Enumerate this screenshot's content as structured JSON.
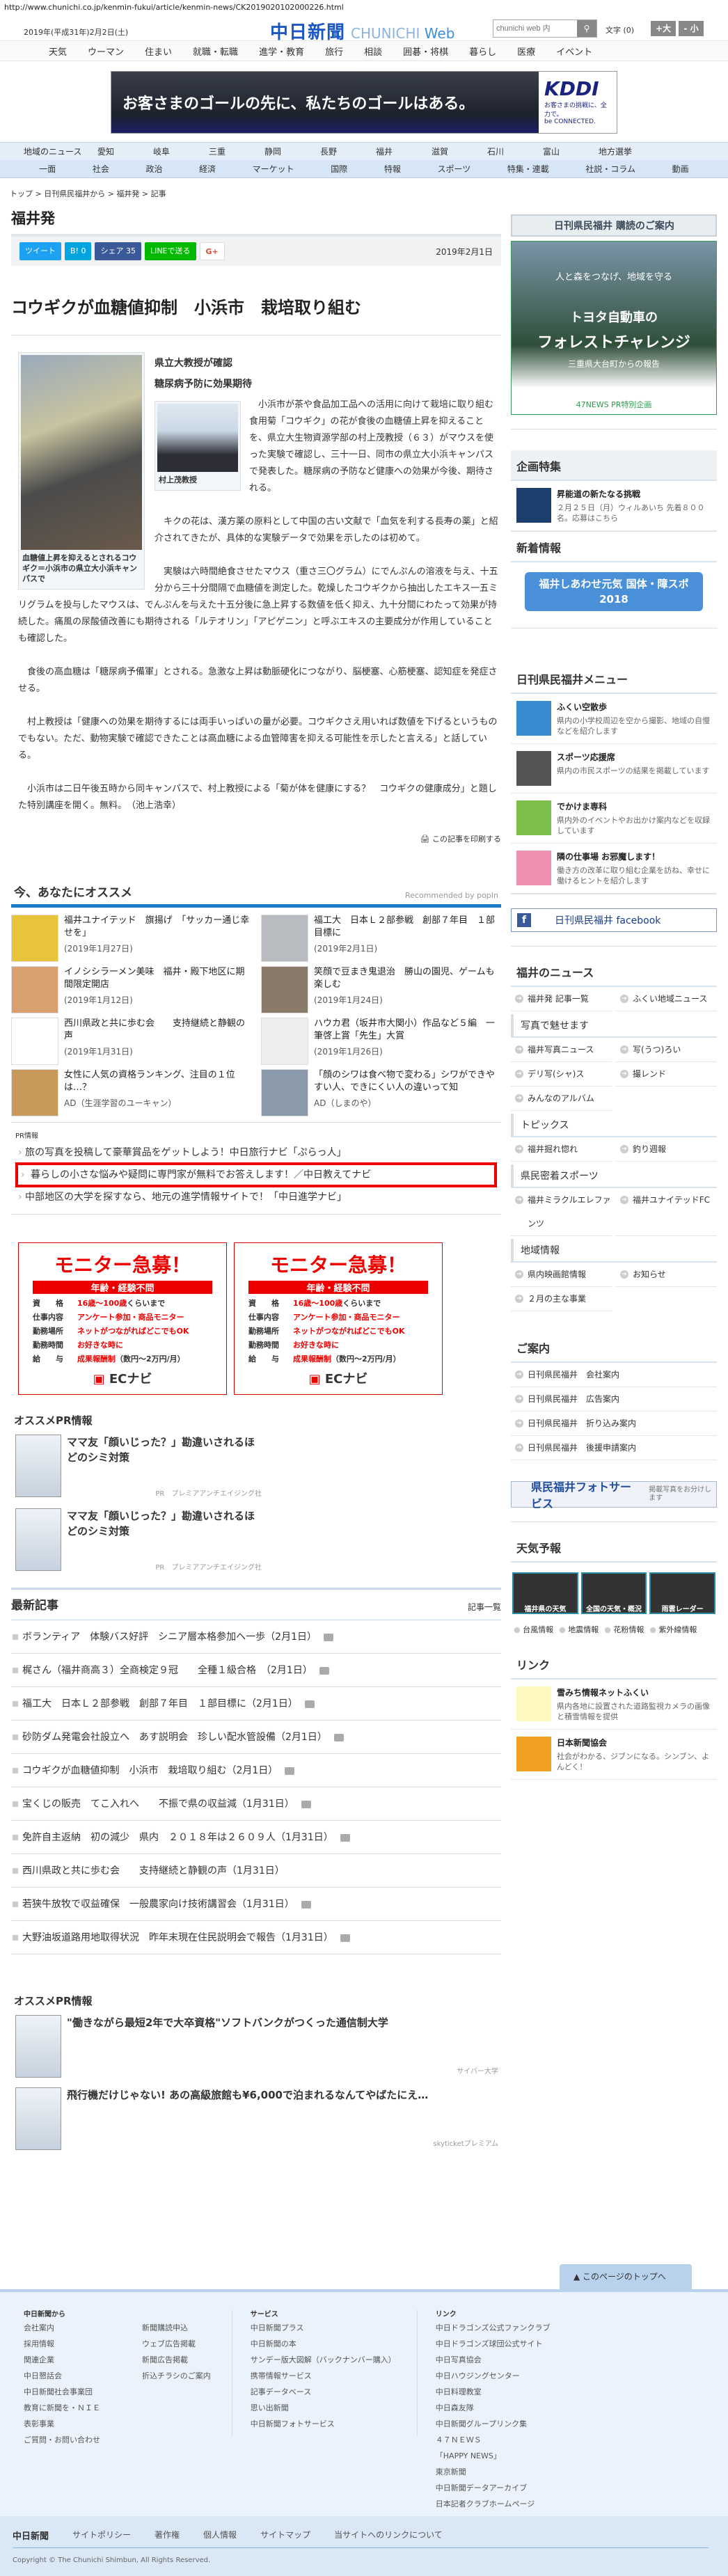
{
  "url": "http://www.chunichi.co.jp/kenmin-fukui/article/kenmin-news/CK2019020102000226.html",
  "header": {
    "date": "2019年(平成31年)2月2日(土)",
    "logo": "中日新聞",
    "logo_sub_a": "CHUNICHI ",
    "logo_sub_b": "Web",
    "search_placeholder": "chunichi web 内",
    "font_label": "文字 (0)",
    "font_plus": "+大",
    "font_minus": "- 小"
  },
  "top_nav": [
    "天気",
    "ウーマン",
    "住まい",
    "就職・転職",
    "進学・教育",
    "旅行",
    "相談",
    "囲碁・将棋",
    "暮らし",
    "医療",
    "イベント"
  ],
  "banner": {
    "text": "お客さまのゴールの先に、私たちのゴールはある。",
    "brand": "KDDI",
    "tagline": "お客さまの挑戦に、全力で。",
    "sub": "be CONNECTED."
  },
  "region_nav": {
    "label": "地域のニュース",
    "items": [
      "愛知",
      "岐阜",
      "三重",
      "静岡",
      "長野",
      "福井",
      "滋賀",
      "石川",
      "富山",
      "地方選挙"
    ]
  },
  "cat_nav": [
    "一面",
    "社会",
    "政治",
    "経済",
    "マーケット",
    "国際",
    "特報",
    "スポーツ",
    "特集・連載",
    "社説・コラム",
    "動画"
  ],
  "breadcrumb": "トップ > 日刊県民福井から > 福井発 > 記事",
  "section": "福井発",
  "share": {
    "tweet": "ツイート",
    "hatena": "B! 0",
    "fb": "シェア 35",
    "line": "LINEで送る",
    "gplus": "G+",
    "date": "2019年2月1日"
  },
  "article": {
    "title": "コウギクが血糖値抑制　小浜市　栽培取り組む",
    "sub1": "県立大教授が確認",
    "sub2": "糖尿病予防に効果期待",
    "photo_caption": "血糖値上昇を抑えるとされるコウギク＝小浜市の県立大小浜キャンパスで",
    "portrait_caption": "村上茂教授",
    "paras": [
      "小浜市が茶や食品加工品への活用に向けて栽培に取り組む食用菊「コウギク」の花が食後の血糖値上昇を抑えることを、県立大生物資源学部の村上茂教授（６３）がマウスを使った実験で確認し、三十一日、同市の県立大小浜キャンパスで発表した。糖尿病の予防など健康への効果が今後、期待される。",
      "キクの花は、漢方薬の原料として中国の古い文献で「血気を利する長寿の薬」と紹介されてきたが、具体的な実験データで効果を示したのは初めて。",
      "実験は六時間絶食させたマウス（重さ三〇グラム）にでんぷんの溶液を与え、十五分から三十分間隔で血糖値を測定した。乾燥したコウギクから抽出したエキス一五ミリグラムを投与したマウスは、でんぷんを与えた十五分後に急上昇する数値を低く抑え、九十分間にわたって効果が持続した。痛風の尿酸値改善にも期待される「ルテオリン」「アピゲニン」と呼ぶエキスの主要成分が作用していることも確認した。",
      "食後の高血糖は「糖尿病予備軍」とされる。急激な上昇は動脈硬化につながり、脳梗塞、心筋梗塞、認知症を発症させる。",
      "村上教授は「健康への効果を期待するには両手いっぱいの量が必要。コウギクさえ用いれば数値を下げるというものでもない。ただ、動物実験で確認できたことは高血糖による血管障害を抑える可能性を示したと言える」と話している。",
      "小浜市は二日午後五時から同キャンパスで、村上教授による「菊が体を健康にする？　コウギクの健康成分」と題した特別講座を開く。無料。　（池上浩幸）"
    ],
    "print": "この記事を印刷する"
  },
  "recommend": {
    "title": "今、あなたにオススメ",
    "by": "Recommended by popIn",
    "items": [
      {
        "title": "福井ユナイテッド　旗揚げ　「サッカー通じ幸せを」",
        "date": "(2019年1月27日)"
      },
      {
        "title": "福工大　日本Ｌ２部参戦　創部７年目　１部目標に",
        "date": "(2019年2月1日)"
      },
      {
        "title": "イノシシラーメン美味　福井・殿下地区に期間限定開店",
        "date": "(2019年1月12日)"
      },
      {
        "title": "笑顔で豆まき鬼退治　勝山の園児、ゲームも楽しむ",
        "date": "(2019年1月24日)"
      },
      {
        "title": "西川県政と共に歩む会　　支持継続と静観の声",
        "date": "(2019年1月31日)"
      },
      {
        "title": "ハウカ君（坂井市大関小）作品など５編　一筆啓上賞「先生」大賞",
        "date": "(2019年1月26日)"
      },
      {
        "title": "女性に人気の資格ランキング、注目の１位は…？",
        "date": "AD（生涯学習のユーキャン）"
      },
      {
        "title": "「顔のシワは食べ物で変わる」シワができやすい人、できにくい人の違いって知",
        "date": "AD（しまのや）"
      }
    ]
  },
  "pr_info": {
    "label": "PR情報",
    "items": [
      "旅の写真を投稿して豪華賞品をゲットしよう！中日旅行ナビ「ぷらっ人」",
      "暮らしの小さな悩みや疑問に専門家が無料でお答えします！／中日教えてナビ",
      "中部地区の大学を探すなら、地元の進学情報サイトで！「中日進学ナビ」"
    ]
  },
  "monitor_ad": {
    "title": "モニター急募！",
    "band": "年齢・経験不問",
    "rows": [
      [
        "資　　格",
        "16歳～100歳",
        "くらいまで"
      ],
      [
        "仕事内容",
        "アンケート参加・商品モニター",
        ""
      ],
      [
        "勤務場所",
        "ネットがつながればどこでもOK",
        ""
      ],
      [
        "勤務時間",
        "お好きな時に",
        ""
      ],
      [
        "給　　与",
        "成果報酬制",
        "（数円～2万円/月）"
      ]
    ],
    "logo": "ECナビ"
  },
  "osusume_pr": {
    "title": "オススメPR情報",
    "items": [
      {
        "title": "ママ友「顔いじった？」勘違いされるほどのシミ対策",
        "src": "PR　プレミアアンチエイジング社"
      },
      {
        "title": "ママ友「顔いじった？」勘違いされるほどのシミ対策",
        "src": "PR　プレミアアンチエイジング社"
      }
    ]
  },
  "latest": {
    "title": "最新記事",
    "more": "記事一覧",
    "items": [
      {
        "t": "ボランティア　体験バス好評　シニア層本格参加へ一歩（2月1日）",
        "cam": true
      },
      {
        "t": "梶さん（福井商高３）全商検定９冠　　全種１級合格　（2月1日）",
        "cam": true
      },
      {
        "t": "福工大　日本Ｌ２部参戦　創部７年目　１部目標に（2月1日）",
        "cam": true
      },
      {
        "t": "砂防ダム発電会社設立へ　あす説明会　珍しい配水管設備（2月1日）",
        "cam": true
      },
      {
        "t": "コウギクが血糖値抑制　小浜市　栽培取り組む（2月1日）",
        "cam": true
      },
      {
        "t": "宝くじの販売　てこ入れへ　　不振で県の収益減（1月31日）",
        "cam": true
      },
      {
        "t": "免許自主返納　初の減少　県内　２０１８年は２６０９人（1月31日）",
        "cam": true
      },
      {
        "t": "西川県政と共に歩む会　　支持継続と静観の声（1月31日）",
        "cam": false
      },
      {
        "t": "若狭牛放牧で収益確保　一般農家向け技術講習会（1月31日）",
        "cam": true
      },
      {
        "t": "大野油坂道路用地取得状況　昨年末現在住民説明会で報告（1月31日）",
        "cam": true
      }
    ]
  },
  "osusume_pr2": {
    "title": "オススメPR情報",
    "items": [
      {
        "title": "\"働きながら最短2年で大卒資格\"ソフトバンクがつくった通信制大学",
        "src": "サイバー大学"
      },
      {
        "title": "飛行機だけじゃない! あの高級旅館も¥6,000で泊まれるなんてやばたにえ…",
        "src": "skyticketプレミアム"
      }
    ]
  },
  "sidebar": {
    "subscribe": "日刊県民福井 購読のご案内",
    "forest": {
      "l1": "人と森をつなげ、地域を守る",
      "l2": "トヨタ自動車の",
      "l3": "フォレストチャレンジ",
      "l4": "三重県大台町からの報告",
      "l5": "47NEWS PR特別企画"
    },
    "kikaku": {
      "title": "企画特集",
      "item": {
        "t": "昇能道の新たなる挑戦",
        "d": "２月２５日（月）ウィルあいち 先着８００名。応募はこちら"
      }
    },
    "shinchaku": {
      "title": "新着情報",
      "banner": "福井しあわせ元気 国体・障スポ2018"
    },
    "menu": {
      "title": "日刊県民福井メニュー",
      "items": [
        {
          "t": "ふくい空散歩",
          "d": "県内の小学校周辺を空から撮影、地域の自慢などを紹介します"
        },
        {
          "t": "スポーツ応援席",
          "d": "県内の市民スポーツの結果を掲載しています"
        },
        {
          "t": "でかけま専科",
          "d": "県内外のイベントやお出かけ案内などを収録しています"
        },
        {
          "t": "隣の仕事場 お邪魔します！",
          "d": "働き方の改革に取り組む企業を訪ね、幸せに働けるヒントを紹介します"
        }
      ]
    },
    "facebook": "日刊県民福井 facebook",
    "news": {
      "title": "福井のニュース",
      "top": [
        "福井発 記事一覧",
        "ふくい地域ニュース"
      ],
      "groups": [
        {
          "h": "写真で魅せます",
          "items": [
            "福井写真ニュース",
            "写(うつ)ろい",
            "デリ写(シャ)ス",
            "撮レンド",
            "みんなのアルバム"
          ]
        },
        {
          "h": "トピックス",
          "items": [
            "福井掘れ惚れ",
            "釣り週報"
          ]
        },
        {
          "h": "県民密着スポーツ",
          "items": [
            "福井ミラクルエレファンツ",
            "福井ユナイテッドFC"
          ]
        },
        {
          "h": "地域情報",
          "items": [
            "県内映画館情報",
            "お知らせ",
            "２月の主な事業"
          ]
        }
      ]
    },
    "annai": {
      "title": "ご案内",
      "items": [
        "日刊県民福井　会社案内",
        "日刊県民福井　広告案内",
        "日刊県民福井　折り込み案内",
        "日刊県民福井　後援申請案内"
      ]
    },
    "photo_service": {
      "t": "県民福井フォトサービス",
      "s": "掲載写真をお分けします"
    },
    "weather": {
      "title": "天気予報",
      "tiles": [
        "福井県の天気",
        "全国の天気・概況",
        "雨雲レーダー"
      ],
      "links": [
        "台風情報",
        "地震情報",
        "花粉情報",
        "紫外線情報"
      ]
    },
    "links": {
      "title": "リンク",
      "items": [
        {
          "t": "雪みち情報ネットふくい",
          "d": "県内各地に設置された道路監視カメラの画像と積雪情報を提供"
        },
        {
          "t": "日本新聞協会",
          "d": "社会がわかる、ジブンになる。シンブン、よんどく！"
        }
      ]
    }
  },
  "to_top": "このページのトップへ",
  "footer": {
    "c1": {
      "h": "中日新聞から",
      "a": [
        "会社案内",
        "採用情報",
        "関連企業",
        "中日懇話会",
        "中日新聞社会事業団",
        "教育に新聞を・ＮＩＥ",
        "表彰事業",
        "ご質問・お問い合わせ"
      ],
      "b": [
        "新聞購読申込",
        "ウェブ広告掲載",
        "新聞広告掲載",
        "折込チラシのご案内"
      ]
    },
    "c2": {
      "h": "サービス",
      "a": [
        "中日新聞プラス",
        "中日新聞の本",
        "サンデー版大図解（バックナンバー購入）",
        "携帯情報サービス",
        "記事データベース",
        "思い出新聞",
        "中日新聞フォトサービス"
      ]
    },
    "c3": {
      "h": "リンク",
      "a": [
        "中日ドラゴンズ公式ファンクラブ",
        "中日ドラゴンズ球団公式サイト",
        "中日写真協会",
        "中日ハウジングセンター",
        "中日料理教室",
        "中日森友隊",
        "中日新聞グループリンク集",
        "４７ＮＥＷＳ",
        "「HAPPY NEWS」",
        "東京新聞",
        "中日新聞データアーカイブ",
        "日本記者クラブホームページ"
      ]
    },
    "bottom_logo": "中日新聞",
    "bottom": [
      "サイトポリシー",
      "著作権",
      "個人情報",
      "サイトマップ",
      "当サイトへのリンクについて"
    ],
    "copyright": "Copyright © The Chunichi Shimbun, All Rights Reserved."
  }
}
